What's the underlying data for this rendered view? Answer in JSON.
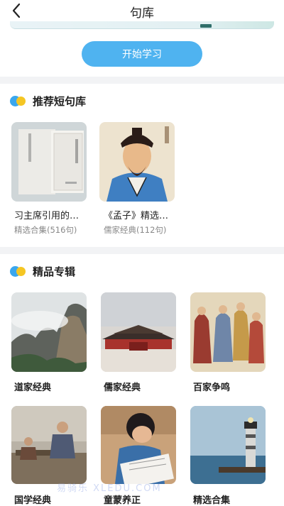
{
  "header": {
    "title": "句库"
  },
  "start_button": {
    "label": "开始学习"
  },
  "recommend": {
    "title": "推荐短句库",
    "items": [
      {
        "title": "习主席引用的…",
        "subtitle": "精选合集(516句)"
      },
      {
        "title": "《孟子》精选…",
        "subtitle": "儒家经典(112句)"
      }
    ]
  },
  "albums": {
    "title": "精品专辑",
    "items": [
      {
        "label": "道家经典"
      },
      {
        "label": "儒家经典"
      },
      {
        "label": "百家争鸣"
      },
      {
        "label": "国学经典"
      },
      {
        "label": "童蒙养正"
      },
      {
        "label": "精选合集"
      }
    ]
  },
  "watermark": "易骑乐 XLEDU.COM",
  "colors": {
    "accent": "#4fb3f0",
    "dot_blue": "#3aa7ee",
    "dot_yellow": "#f5c623"
  }
}
